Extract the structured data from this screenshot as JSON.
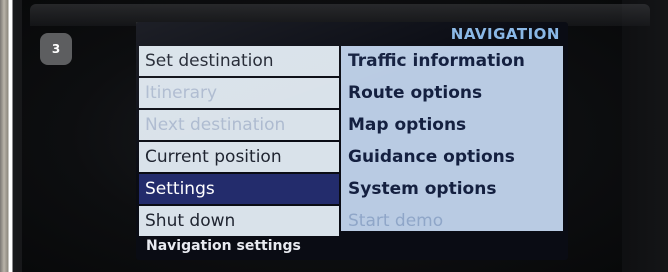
{
  "badge": {
    "number": "3"
  },
  "screen": {
    "title": "NAVIGATION",
    "left_menu": [
      {
        "label": "Set destination",
        "state": "normal"
      },
      {
        "label": "Itinerary",
        "state": "disabled"
      },
      {
        "label": "Next destination",
        "state": "disabled"
      },
      {
        "label": "Current position",
        "state": "normal"
      },
      {
        "label": "Settings",
        "state": "selected"
      },
      {
        "label": "Shut down",
        "state": "normal"
      }
    ],
    "right_menu": [
      {
        "label": "Traffic information",
        "state": "normal"
      },
      {
        "label": "Route options",
        "state": "normal"
      },
      {
        "label": "Map options",
        "state": "normal"
      },
      {
        "label": "Guidance options",
        "state": "normal"
      },
      {
        "label": "System options",
        "state": "normal"
      },
      {
        "label": "Start demo",
        "state": "disabled"
      }
    ],
    "status": "Navigation settings"
  },
  "colors": {
    "selected_bg": "#232c6c",
    "left_bg": "#d9e2ea",
    "right_bg": "#b9cbe3",
    "title": "#8ab8e6"
  }
}
